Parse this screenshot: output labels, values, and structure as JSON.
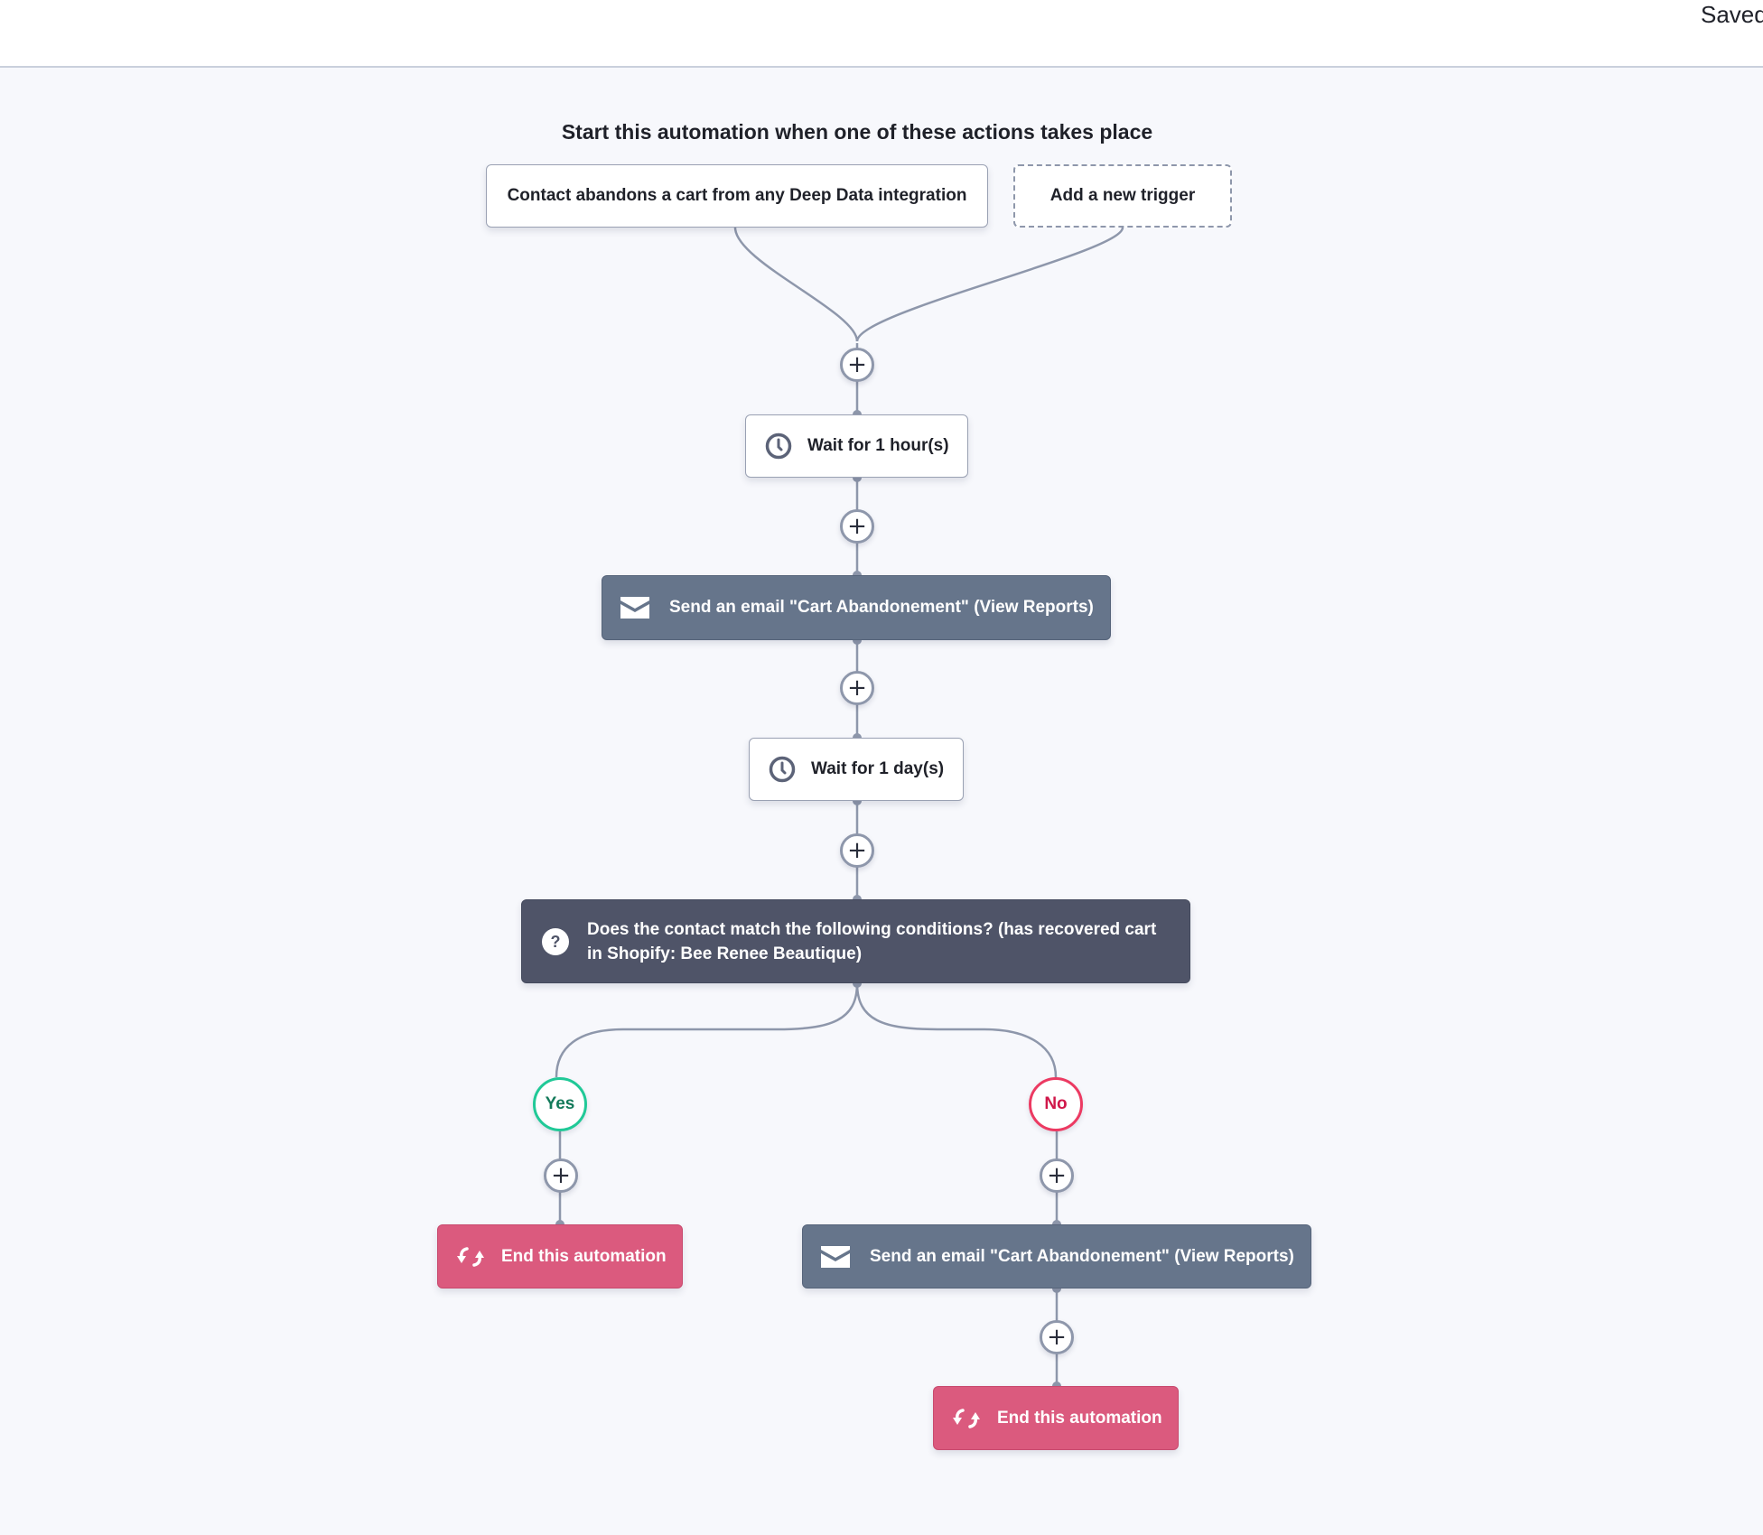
{
  "header": {
    "status_text": "Saved"
  },
  "colors": {
    "background": "#f7f8fc",
    "connector": "#8e97ab",
    "email_node": "#66758b",
    "condition_node": "#4f5468",
    "end_node": "#db5a7e",
    "yes_accent": "#20c997",
    "no_accent": "#ec3a62"
  },
  "workflow": {
    "title": "Start this automation when one of these actions takes place",
    "triggers": [
      {
        "label": "Contact abandons a cart from any Deep Data integration"
      },
      {
        "label": "Add a new trigger",
        "style": "dashed"
      }
    ],
    "add_step_label": "+",
    "steps": [
      {
        "type": "wait",
        "icon": "clock-icon",
        "label": "Wait for 1 hour(s)"
      },
      {
        "type": "email",
        "icon": "envelope-icon",
        "label": "Send an email \"Cart Abandonement\" (View Reports)"
      },
      {
        "type": "wait",
        "icon": "clock-icon",
        "label": "Wait for 1 day(s)"
      },
      {
        "type": "condition",
        "icon": "question-icon",
        "label": "Does the contact match the following conditions? (has recovered cart in Shopify: Bee Renee Beautique)"
      }
    ],
    "branches": {
      "yes": {
        "label": "Yes",
        "steps": [
          {
            "type": "end",
            "icon": "refresh-arrows-icon",
            "label": "End this automation"
          }
        ]
      },
      "no": {
        "label": "No",
        "steps": [
          {
            "type": "email",
            "icon": "envelope-icon",
            "label": "Send an email \"Cart Abandonement\" (View Reports)"
          },
          {
            "type": "end",
            "icon": "refresh-arrows-icon",
            "label": "End this automation"
          }
        ]
      }
    }
  }
}
